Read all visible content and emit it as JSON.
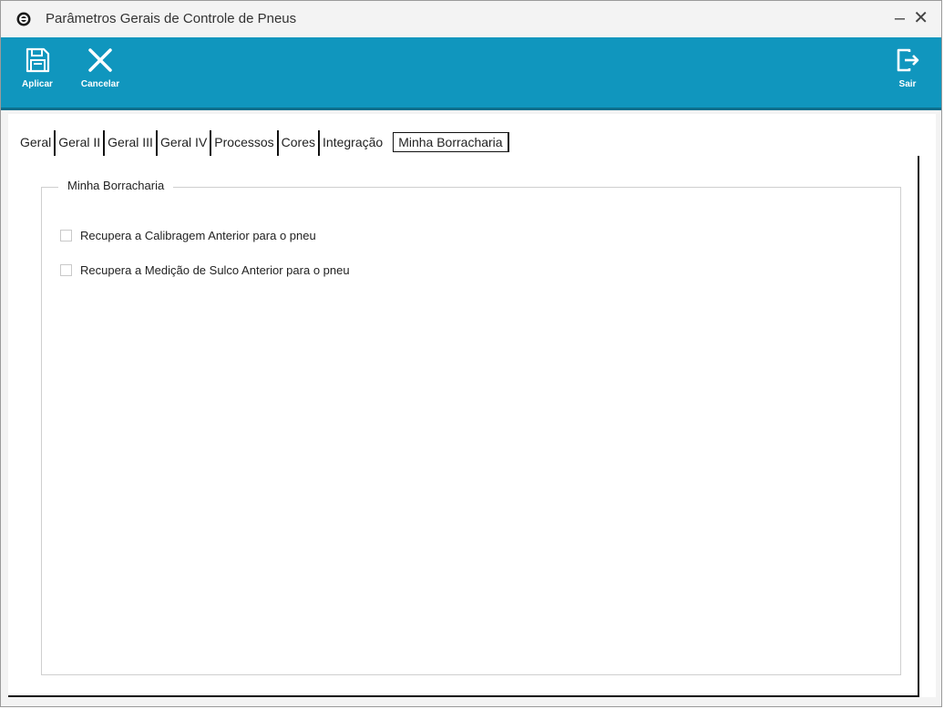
{
  "window": {
    "title": "Parâmetros Gerais de Controle de Pneus",
    "minimize_glyph": "–",
    "close_glyph": "✕"
  },
  "toolbar": {
    "apply_label": "Aplicar",
    "cancel_label": "Cancelar",
    "exit_label": "Sair",
    "icons": {
      "apply": "save-icon",
      "cancel": "close-x-icon",
      "exit": "exit-icon"
    },
    "background_color": "#1096be"
  },
  "tabs": [
    {
      "label": "Geral"
    },
    {
      "label": "Geral II"
    },
    {
      "label": "Geral III"
    },
    {
      "label": "Geral IV"
    },
    {
      "label": "Processos"
    },
    {
      "label": "Cores"
    },
    {
      "label": "Integração"
    },
    {
      "label": "Minha Borracharia",
      "active": true
    }
  ],
  "group": {
    "title": "Minha Borracharia",
    "options": [
      {
        "label": "Recupera a Calibragem Anterior para o pneu",
        "checked": false
      },
      {
        "label": "Recupera a Medição de Sulco Anterior para o pneu",
        "checked": false
      }
    ]
  }
}
